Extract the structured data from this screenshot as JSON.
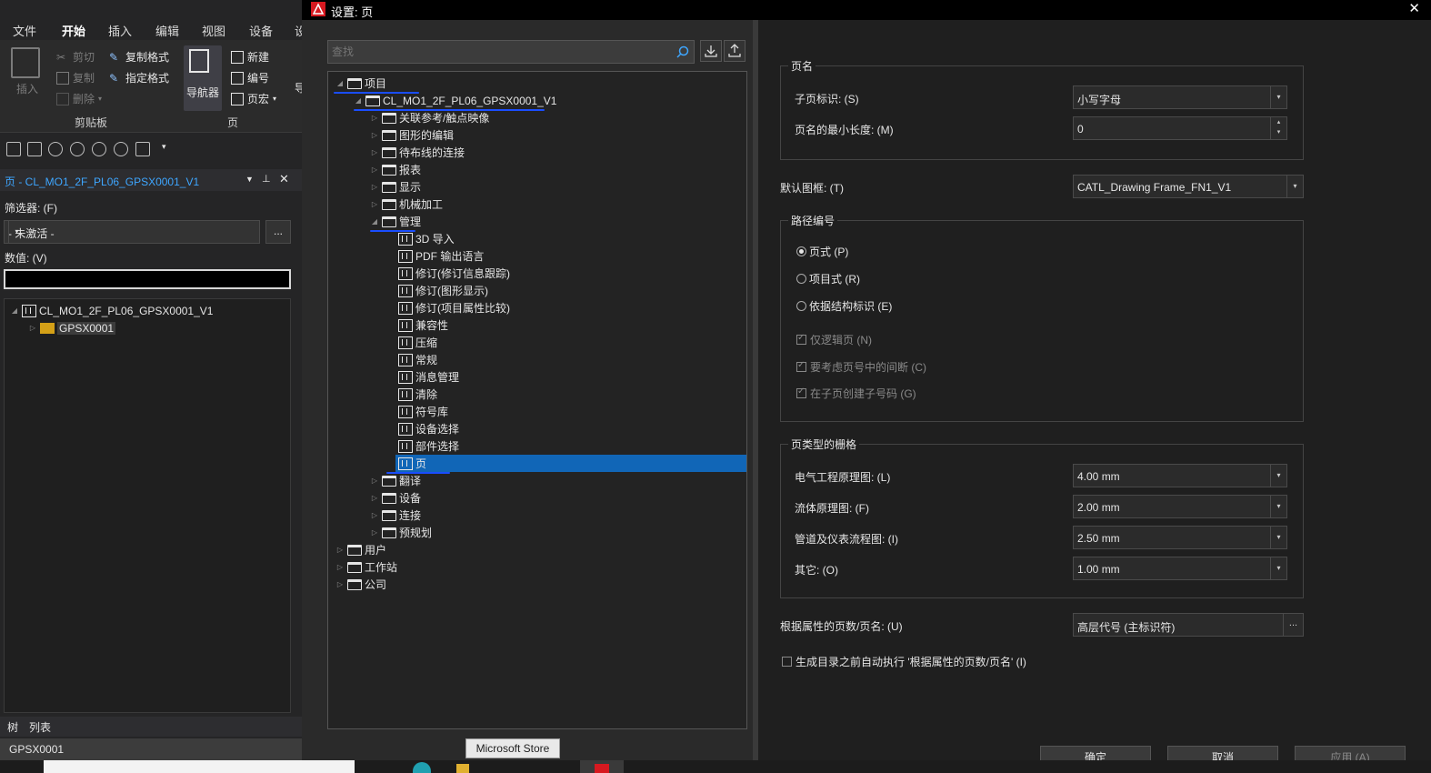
{
  "left_app": {
    "menu": [
      "文件",
      "开始",
      "插入",
      "编辑",
      "视图",
      "设备",
      "设"
    ],
    "active_menu": "开始",
    "ribbon": {
      "paste": "插入",
      "cut": "剪切",
      "copy": "复制",
      "delete": "删除",
      "copy_format": "复制格式",
      "assign_format": "指定格式",
      "clipboard_group": "剪贴板",
      "navigator": "导航器",
      "new": "新建",
      "numbering": "编号",
      "page_macro": "页宏",
      "page_group": "页",
      "right_cut": "导"
    },
    "navigator_title": "页 - CL_MO1_2F_PL06_GPSX0001_V1",
    "filter_label": "筛选器: (F)",
    "filter_value": "- 未激活 -",
    "filter_more": "...",
    "value_label": "数值: (V)",
    "tree": [
      {
        "label": "CL_MO1_2F_PL06_GPSX0001_V1"
      },
      {
        "label": "GPSX0001"
      }
    ],
    "tabs": [
      "树",
      "列表"
    ],
    "status": "GPSX0001"
  },
  "dialog": {
    "title": "设置: 页",
    "search_placeholder": "查找",
    "tree": [
      {
        "label": "项目",
        "kind": "folder",
        "level": 0,
        "exp": "open"
      },
      {
        "label": "CL_MO1_2F_PL06_GPSX0001_V1",
        "kind": "folder",
        "level": 1,
        "exp": "open"
      },
      {
        "label": "关联参考/触点映像",
        "kind": "folder",
        "level": 2,
        "exp": "closed"
      },
      {
        "label": "图形的编辑",
        "kind": "folder",
        "level": 2,
        "exp": "closed"
      },
      {
        "label": "待布线的连接",
        "kind": "folder",
        "level": 2,
        "exp": "closed"
      },
      {
        "label": "报表",
        "kind": "folder",
        "level": 2,
        "exp": "closed"
      },
      {
        "label": "显示",
        "kind": "folder",
        "level": 2,
        "exp": "closed"
      },
      {
        "label": "机械加工",
        "kind": "folder",
        "level": 2,
        "exp": "closed"
      },
      {
        "label": "管理",
        "kind": "folder",
        "level": 2,
        "exp": "open"
      },
      {
        "label": "3D 导入",
        "kind": "page",
        "level": 3
      },
      {
        "label": "PDF 输出语言",
        "kind": "page",
        "level": 3
      },
      {
        "label": "修订(修订信息跟踪)",
        "kind": "page",
        "level": 3
      },
      {
        "label": "修订(图形显示)",
        "kind": "page",
        "level": 3
      },
      {
        "label": "修订(项目属性比较)",
        "kind": "page",
        "level": 3
      },
      {
        "label": "兼容性",
        "kind": "page",
        "level": 3
      },
      {
        "label": "压缩",
        "kind": "page",
        "level": 3
      },
      {
        "label": "常规",
        "kind": "page",
        "level": 3
      },
      {
        "label": "消息管理",
        "kind": "page",
        "level": 3
      },
      {
        "label": "清除",
        "kind": "page",
        "level": 3
      },
      {
        "label": "符号库",
        "kind": "page",
        "level": 3
      },
      {
        "label": "设备选择",
        "kind": "page",
        "level": 3
      },
      {
        "label": "部件选择",
        "kind": "page",
        "level": 3
      },
      {
        "label": "页",
        "kind": "page",
        "level": 3,
        "selected": true
      },
      {
        "label": "翻译",
        "kind": "folder",
        "level": 2,
        "exp": "closed"
      },
      {
        "label": "设备",
        "kind": "folder",
        "level": 2,
        "exp": "closed"
      },
      {
        "label": "连接",
        "kind": "folder",
        "level": 2,
        "exp": "closed"
      },
      {
        "label": "预规划",
        "kind": "folder",
        "level": 2,
        "exp": "closed"
      },
      {
        "label": "用户",
        "kind": "folder",
        "level": 0,
        "exp": "closed"
      },
      {
        "label": "工作站",
        "kind": "folder",
        "level": 0,
        "exp": "closed"
      },
      {
        "label": "公司",
        "kind": "folder",
        "level": 0,
        "exp": "closed"
      }
    ],
    "settings": {
      "page_name_group": "页名",
      "subpage_id_label": "子页标识: (S)",
      "subpage_id_value": "小写字母",
      "min_length_label": "页名的最小长度: (M)",
      "min_length_value": "0",
      "default_frame_label": "默认图框: (T)",
      "default_frame_value": "CATL_Drawing Frame_FN1_V1",
      "path_numbering_group": "路径编号",
      "radio_page": "页式 (P)",
      "radio_project": "项目式 (R)",
      "radio_structure": "依据结构标识 (E)",
      "chk_logical_only": "仅逻辑页 (N)",
      "chk_gaps": "要考虑页号中的间断 (C)",
      "chk_subnumbers": "在子页创建子号码 (G)",
      "grid_group": "页类型的栅格",
      "grid_electrical_label": "电气工程原理图: (L)",
      "grid_electrical_value": "4.00 mm",
      "grid_fluid_label": "流体原理图: (F)",
      "grid_fluid_value": "2.00 mm",
      "grid_pid_label": "管道及仪表流程图: (I)",
      "grid_pid_value": "2.50 mm",
      "grid_other_label": "其它: (O)",
      "grid_other_value": "1.00 mm",
      "prop_page_label": "根据属性的页数/页名: (U)",
      "prop_page_value": "高层代号 (主标识符)",
      "prop_more": "...",
      "auto_exec_label": "生成目录之前自动执行 '根据属性的页数/页名' (I)"
    },
    "buttons": {
      "ok": "确定",
      "cancel": "取消",
      "apply": "应用 (A)"
    }
  },
  "taskbar": {
    "tooltip": "Microsoft Store"
  },
  "colors": {
    "selection": "#1166b7",
    "accent": "#3ea6ff",
    "annotation": "#1a4dff"
  }
}
